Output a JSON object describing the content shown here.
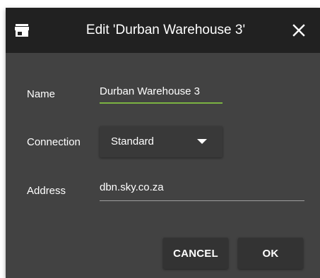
{
  "dialog": {
    "title": "Edit 'Durban Warehouse 3'",
    "title_icon": "store-icon",
    "close_icon": "close-icon"
  },
  "form": {
    "name": {
      "label": "Name",
      "value": "Durban Warehouse 3"
    },
    "connection": {
      "label": "Connection",
      "selected": "Standard",
      "dropdown_icon": "caret-down-icon"
    },
    "address": {
      "label": "Address",
      "value": "dbn.sky.co.za"
    }
  },
  "actions": {
    "cancel_label": "CANCEL",
    "ok_label": "OK"
  },
  "colors": {
    "titlebar": "#212121",
    "dialog_background": "#424242",
    "focused_underline": "#7cb342",
    "text": "#ffffff"
  }
}
